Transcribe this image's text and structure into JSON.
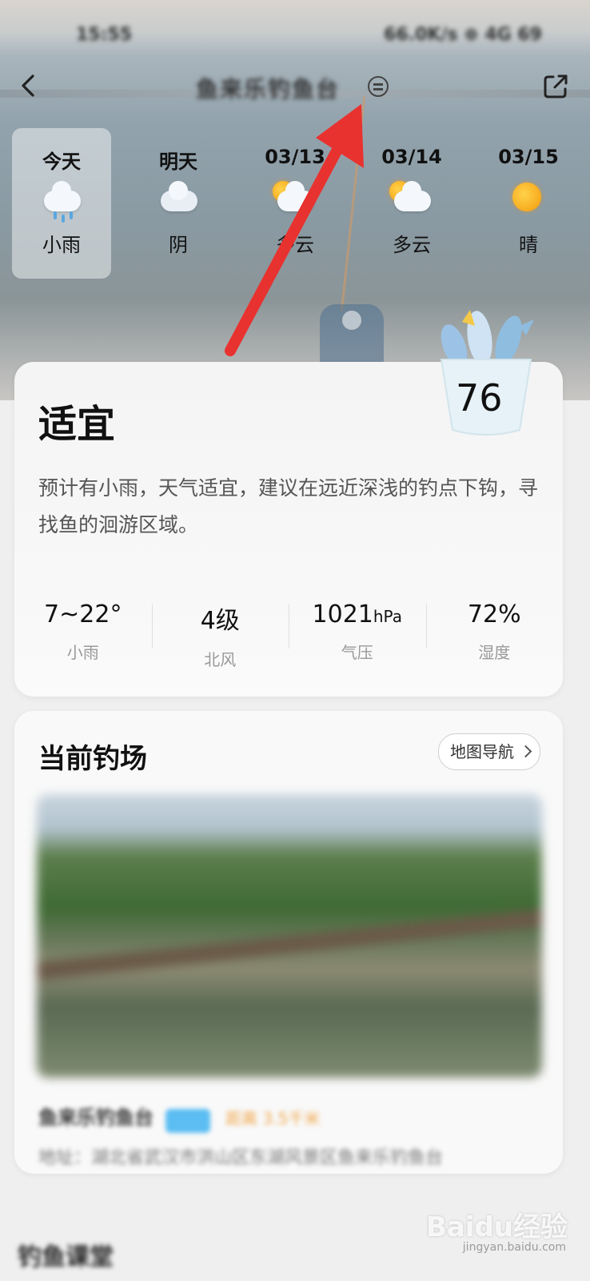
{
  "status_bar": {
    "time": "15:55",
    "right": "66.0K/s ⊕ 4G 69"
  },
  "nav": {
    "back_icon": "chevron-left-icon",
    "title": "鱼来乐钓鱼台",
    "switch_icon": "switch-icon",
    "share_icon": "share-icon"
  },
  "forecast": [
    {
      "label": "今天",
      "icon": "light-rain-icon",
      "condition": "小雨",
      "active": true
    },
    {
      "label": "明天",
      "icon": "overcast-icon",
      "condition": "阴",
      "active": false
    },
    {
      "label": "03/13",
      "icon": "partly-cloudy-icon",
      "condition": "多云",
      "active": false
    },
    {
      "label": "03/14",
      "icon": "partly-cloudy-icon",
      "condition": "多云",
      "active": false
    },
    {
      "label": "03/15",
      "icon": "sunny-icon",
      "condition": "晴",
      "active": false
    }
  ],
  "index_card": {
    "rating": "适宜",
    "score": "76",
    "suggestion": "预计有小雨，天气适宜，建议在远近深浅的钓点下钩，寻找鱼的洄游区域。",
    "stats": [
      {
        "value": "7~22°",
        "unit": "",
        "label": "小雨"
      },
      {
        "value": "4级",
        "unit": "",
        "label": "北风"
      },
      {
        "value": "1021",
        "unit": "hPa",
        "label": "气压"
      },
      {
        "value": "72%",
        "unit": "",
        "label": "湿度"
      }
    ]
  },
  "spot_card": {
    "title": "当前钓场",
    "nav_button": "地图导航",
    "name": "鱼来乐钓鱼台",
    "distance": "距离 3.5千米",
    "address": "地址：湖北省武汉市洪山区东湖风景区鱼来乐钓鱼台"
  },
  "next_section": {
    "title": "钓鱼课堂"
  },
  "watermark": {
    "text": "Baidu经验",
    "sub": "jingyan.baidu.com"
  },
  "colors": {
    "annotation_arrow": "#e8322f",
    "badge": "#5bbdf2",
    "distance": "#f0a64a"
  }
}
